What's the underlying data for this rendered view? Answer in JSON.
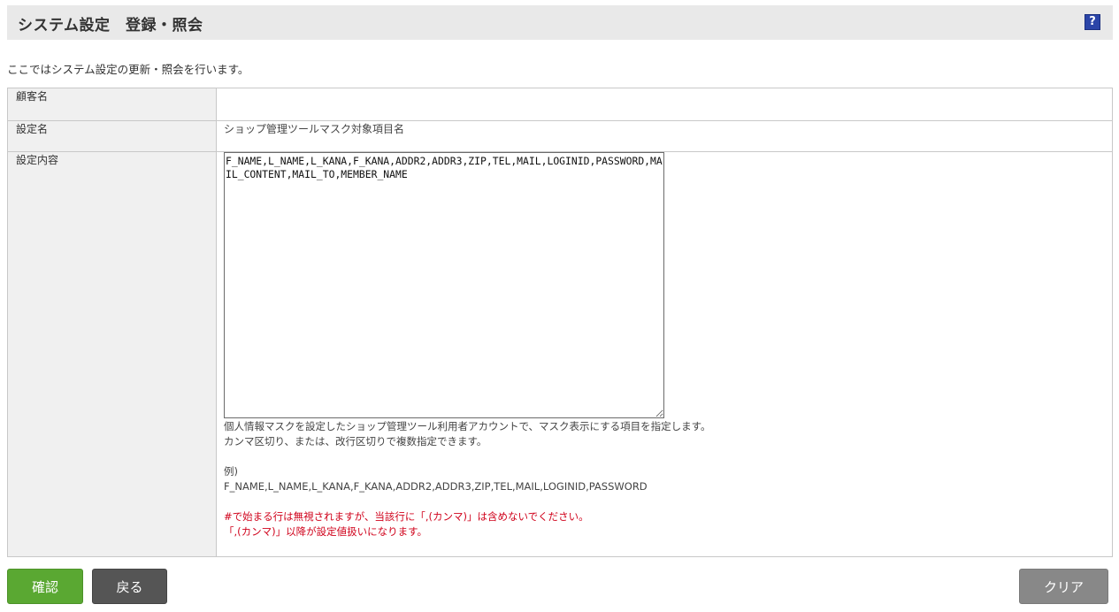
{
  "header": {
    "title": "システム設定　登録・照会",
    "help_icon_glyph": "?"
  },
  "intro": "ここではシステム設定の更新・照会を行います。",
  "form": {
    "rows": [
      {
        "label": "顧客名",
        "value": ""
      },
      {
        "label": "設定名",
        "value": "ショップ管理ツールマスク対象項目名"
      },
      {
        "label": "設定内容"
      }
    ],
    "setting_value": "F_NAME,L_NAME,L_KANA,F_KANA,ADDR2,ADDR3,ZIP,TEL,MAIL,LOGINID,PASSWORD,MAIL_CONTENT,MAIL_TO,MEMBER_NAME",
    "help_lines": [
      "個人情報マスクを設定したショップ管理ツール利用者アカウントで、マスク表示にする項目を指定します。",
      "カンマ区切り、または、改行区切りで複数指定できます。"
    ],
    "example_label": "例)",
    "example_value": "F_NAME,L_NAME,L_KANA,F_KANA,ADDR2,ADDR3,ZIP,TEL,MAIL,LOGINID,PASSWORD",
    "warnings": [
      "#で始まる行は無視されますが、当該行に「,(カンマ)」は含めないでください。",
      "「,(カンマ)」以降が設定値扱いになります。"
    ]
  },
  "buttons": {
    "confirm": "確認",
    "back": "戻る",
    "clear": "クリア"
  },
  "colors": {
    "header_bg": "#e9e9e9",
    "confirm_green": "#5aa832",
    "back_dark": "#555555",
    "clear_gray": "#888888",
    "warning_red": "#d0021b",
    "help_icon_blue": "#2b45a8"
  }
}
